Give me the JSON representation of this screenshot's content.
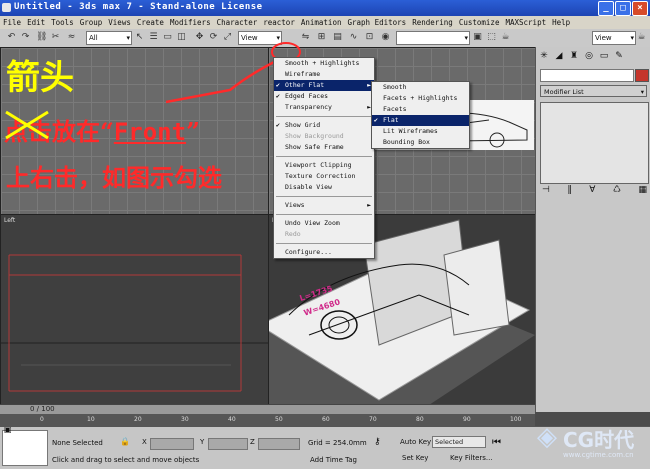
{
  "title": "Untitled  - 3ds max 7  - Stand-alone License",
  "window_buttons": [
    "_",
    "□",
    "×"
  ],
  "menubar": [
    "File",
    "Edit",
    "Tools",
    "Group",
    "Views",
    "Create",
    "Modifiers",
    "Character",
    "reactor",
    "Animation",
    "Graph Editors",
    "Rendering",
    "Customize",
    "MAXScript",
    "Help"
  ],
  "toolbar": {
    "selection_filter": "All",
    "ref_coord": "View",
    "named_sel": "",
    "view_dropdown": "View"
  },
  "viewports": {
    "top_left_label": "",
    "front_label": "",
    "left_label": "Left",
    "perspective_label": "Pe"
  },
  "annotation": {
    "line1": "箭头",
    "line2_struck": "点击",
    "line2_rest": "放在“",
    "line2_front": "Front",
    "line2_end": "”",
    "line3": "上右击，如图示勾选"
  },
  "context_menu": {
    "items": [
      {
        "label": "Smooth + Highlights",
        "check": false,
        "arrow": false,
        "state": "normal"
      },
      {
        "label": "Wireframe",
        "check": false,
        "arrow": false,
        "state": "normal"
      },
      {
        "label": "Other  Flat",
        "check": true,
        "arrow": true,
        "state": "hl"
      },
      {
        "label": "Edged Faces",
        "check": true,
        "arrow": false,
        "state": "normal"
      },
      {
        "label": "Transparency",
        "check": false,
        "arrow": true,
        "state": "normal"
      },
      {
        "sep": true
      },
      {
        "label": "Show Grid",
        "check": true,
        "arrow": false,
        "state": "normal"
      },
      {
        "label": "Show Background",
        "check": false,
        "arrow": false,
        "state": "dis"
      },
      {
        "label": "Show Safe Frame",
        "check": false,
        "arrow": false,
        "state": "normal"
      },
      {
        "sep": true
      },
      {
        "label": "Viewport Clipping",
        "check": false,
        "arrow": false,
        "state": "normal"
      },
      {
        "label": "Texture Correction",
        "check": false,
        "arrow": false,
        "state": "normal"
      },
      {
        "label": "Disable View",
        "check": false,
        "arrow": false,
        "state": "normal"
      },
      {
        "sep": true
      },
      {
        "label": "Views",
        "check": false,
        "arrow": true,
        "state": "normal"
      },
      {
        "sep": true
      },
      {
        "label": "Undo View Zoom",
        "check": false,
        "arrow": false,
        "state": "normal"
      },
      {
        "label": "Redo",
        "check": false,
        "arrow": false,
        "state": "dis"
      },
      {
        "sep": true
      },
      {
        "label": "Configure...",
        "check": false,
        "arrow": false,
        "state": "normal"
      }
    ]
  },
  "submenu": {
    "items": [
      {
        "label": "Smooth",
        "check": false,
        "state": "normal"
      },
      {
        "label": "Facets + Highlights",
        "check": false,
        "state": "normal"
      },
      {
        "label": "Facets",
        "check": false,
        "state": "normal"
      },
      {
        "label": "Flat",
        "check": true,
        "state": "hl"
      },
      {
        "label": "Lit Wireframes",
        "check": false,
        "state": "normal"
      },
      {
        "label": "Bounding Box",
        "check": false,
        "state": "normal"
      }
    ]
  },
  "command_panel": {
    "modifier_list": "Modifier List"
  },
  "car_labels": {
    "l": "L=1735",
    "w": "W=4680"
  },
  "timeline": {
    "frame_label": "0 / 100",
    "ticks": [
      "0",
      "10",
      "20",
      "30",
      "40",
      "50",
      "60",
      "70",
      "80",
      "90",
      "100"
    ]
  },
  "status": {
    "selection": "None Selected",
    "x_label": "X",
    "y_label": "Y",
    "z_label": "Z",
    "grid": "Grid = 254.0mm",
    "auto_key": "Auto Key",
    "set_key": "Set Key",
    "selected_dropdown": "Selected",
    "key_filters": "Key Filters...",
    "add_time_tag": "Add Time Tag",
    "prompt": "Click and drag to select and move objects"
  },
  "watermark": {
    "brand": "CG时代",
    "url": "www.cgtime.com.cn"
  },
  "colors": {
    "annotation_yellow": "#ffff00",
    "annotation_red": "#ff2a2a",
    "highlight": "#0a246a"
  }
}
